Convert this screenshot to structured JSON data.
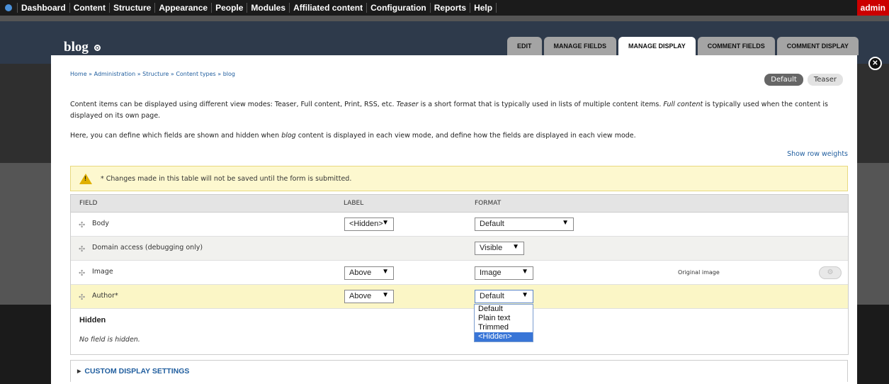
{
  "toolbar": {
    "items": [
      "Dashboard",
      "Content",
      "Structure",
      "Appearance",
      "People",
      "Modules",
      "Affiliated content",
      "Configuration",
      "Reports",
      "Help"
    ],
    "user": "admin"
  },
  "header": {
    "title": "blog",
    "tabs": [
      "EDIT",
      "MANAGE FIELDS",
      "MANAGE DISPLAY",
      "COMMENT FIELDS",
      "COMMENT DISPLAY"
    ],
    "active_tab": "MANAGE DISPLAY"
  },
  "breadcrumb": "Home » Administration » Structure » Content types » blog",
  "view_modes": [
    "Default",
    "Teaser"
  ],
  "description": {
    "p1_a": "Content items can be displayed using different view modes: Teaser, Full content, Print, RSS, etc. ",
    "p1_b": "Teaser",
    "p1_c": " is a short format that is typically used in lists of multiple content items. ",
    "p1_d": "Full content",
    "p1_e": " is typically used when the content is displayed on its own page.",
    "p2_a": "Here, you can define which fields are shown and hidden when ",
    "p2_b": "blog",
    "p2_c": " content is displayed in each view mode, and define how the fields are displayed in each view mode."
  },
  "show_row_weights": "Show row weights",
  "warning": "* Changes made in this table will not be saved until the form is submitted.",
  "table": {
    "headers": [
      "FIELD",
      "LABEL",
      "FORMAT"
    ],
    "rows": [
      {
        "field": "Body",
        "label": "<Hidden>",
        "format": "Default",
        "summary": ""
      },
      {
        "field": "Domain access (debugging only)",
        "label": "",
        "format": "Visible",
        "summary": ""
      },
      {
        "field": "Image",
        "label": "Above",
        "format": "Image",
        "summary": "Original image"
      },
      {
        "field": "Author*",
        "label": "Above",
        "format": "Default",
        "summary": ""
      }
    ],
    "hidden_title": "Hidden",
    "hidden_empty": "No field is hidden."
  },
  "format_dropdown": {
    "options": [
      "Default",
      "Plain text",
      "Trimmed",
      "<Hidden>"
    ],
    "highlighted": "<Hidden>"
  },
  "custom_display_settings": "CUSTOM DISPLAY SETTINGS",
  "colors": {
    "toolbar": "#1b1b1b",
    "admin": "#cc0000",
    "link": "#1f5d9e",
    "warning_bg": "#fdf8cf"
  },
  "icons": {
    "home": "drupal-icon",
    "close": "close-icon",
    "warning": "warning-icon",
    "drag": "drag-handle-icon",
    "gear": "gear-icon"
  }
}
